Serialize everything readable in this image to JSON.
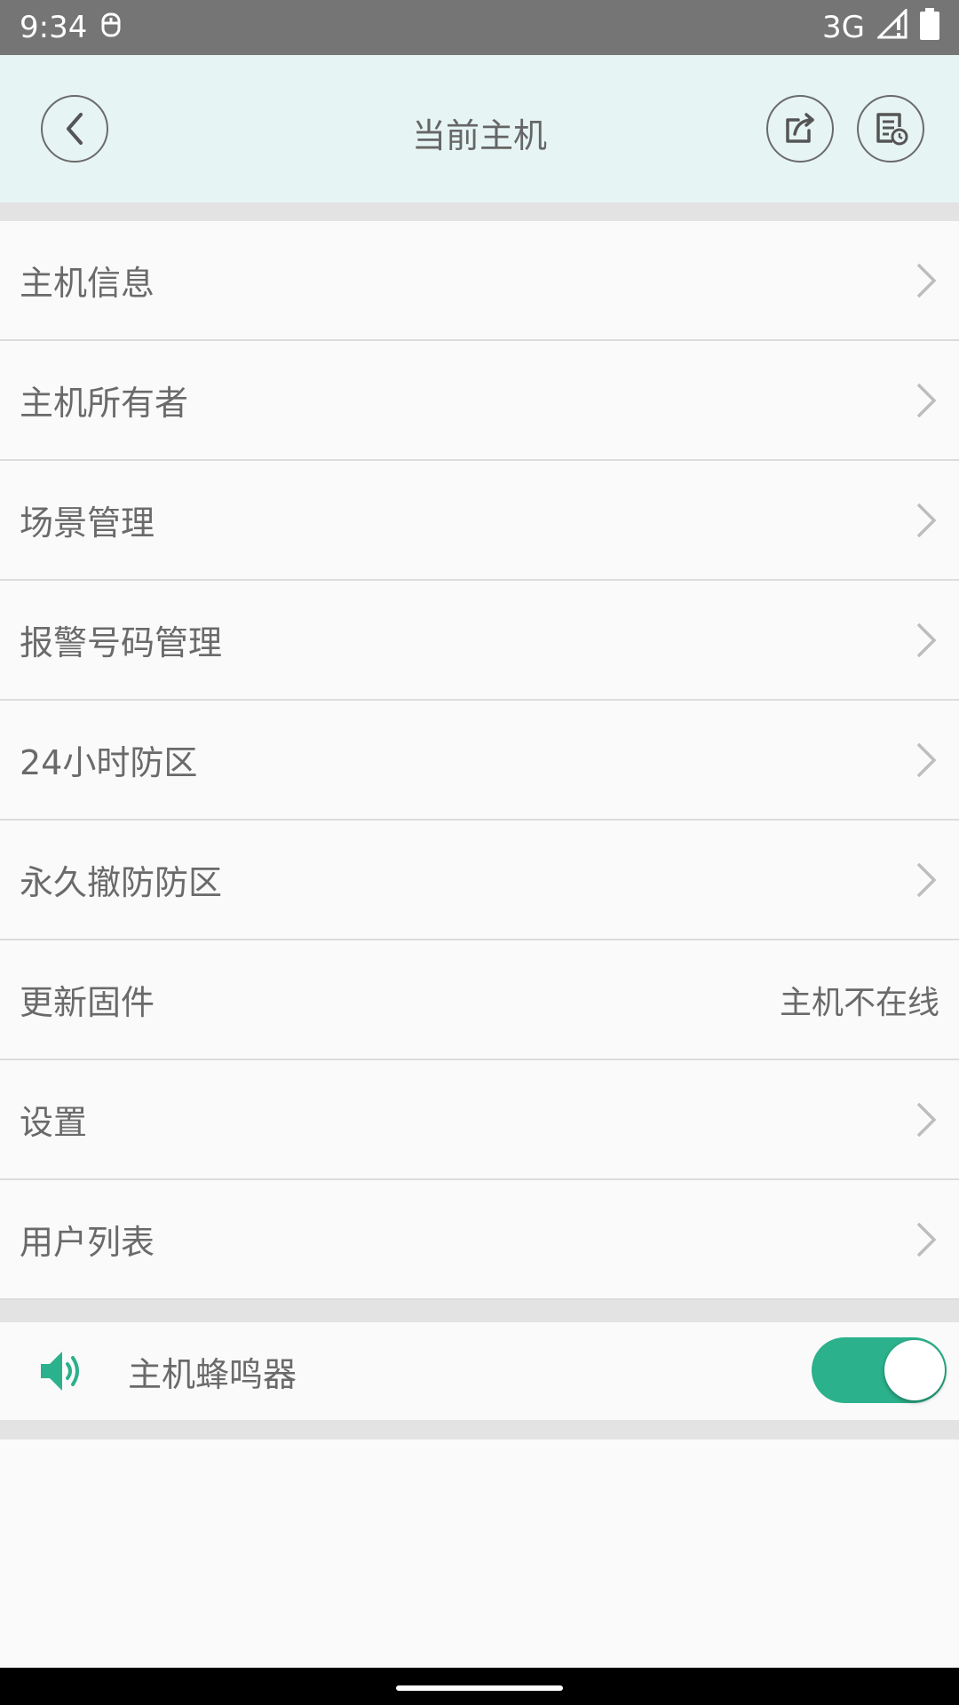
{
  "status_bar": {
    "time": "9:34",
    "network": "3G",
    "icons": [
      "usb-icon",
      "signal-icon",
      "battery-icon"
    ]
  },
  "header": {
    "title": "当前主机",
    "back_icon": "chevron-left-icon",
    "share_icon": "share-icon",
    "log_icon": "log-history-icon"
  },
  "menu": {
    "items": [
      {
        "label": "主机信息",
        "chevron": true
      },
      {
        "label": "主机所有者",
        "chevron": true
      },
      {
        "label": "场景管理",
        "chevron": true
      },
      {
        "label": "报警号码管理",
        "chevron": true
      },
      {
        "label": "24小时防区",
        "chevron": true
      },
      {
        "label": "永久撤防防区",
        "chevron": true
      },
      {
        "label": "更新固件",
        "value": "主机不在线"
      },
      {
        "label": "设置",
        "chevron": true
      },
      {
        "label": "用户列表",
        "chevron": true
      }
    ]
  },
  "buzzer": {
    "label": "主机蜂鸣器",
    "icon": "speaker-icon",
    "enabled": true
  },
  "colors": {
    "accent": "#2bb18b",
    "header_bg": "#e6f4f3",
    "status_bar": "#757575"
  }
}
